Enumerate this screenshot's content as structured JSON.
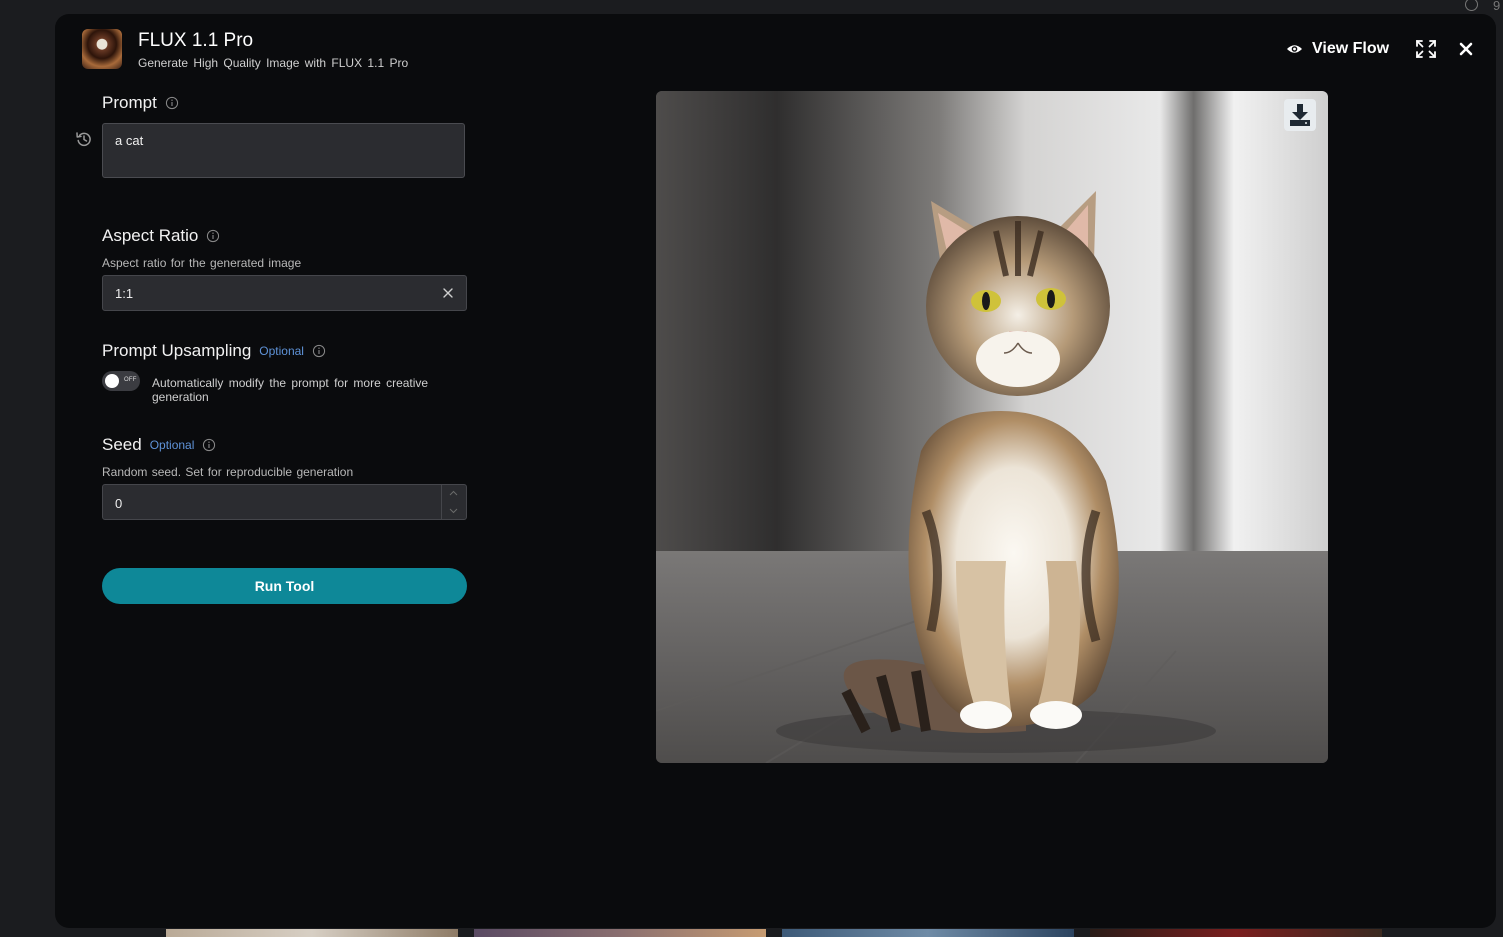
{
  "app": {
    "title": "FLUX 1.1 Pro",
    "subtitle": "Generate High Quality Image with FLUX 1.1 Pro",
    "logo_icon": "cake-avatar",
    "corner_indicator": "9"
  },
  "header": {
    "view_flow_label": "View Flow",
    "eye_icon": "eye-icon",
    "expand_icon": "expand-icon",
    "close_icon": "close-icon"
  },
  "form": {
    "prompt": {
      "label": "Prompt",
      "value": "a cat"
    },
    "aspect_ratio": {
      "label": "Aspect Ratio",
      "help": "Aspect ratio for the generated image",
      "value": "1:1"
    },
    "prompt_upsampling": {
      "label": "Prompt Upsampling",
      "optional": "Optional",
      "toggle_state": "OFF",
      "enabled": false,
      "description": "Automatically modify the prompt for more creative generation"
    },
    "seed": {
      "label": "Seed",
      "optional": "Optional",
      "help": "Random seed. Set for reproducible generation",
      "value": "0"
    },
    "run_label": "Run Tool"
  },
  "output": {
    "image_icon": "cat-photo",
    "download_icon": "download-icon"
  },
  "colors": {
    "accent": "#0e8898",
    "optional": "#5f93d8",
    "modal_bg": "#0a0b0d",
    "input_bg": "#2b2c30"
  }
}
